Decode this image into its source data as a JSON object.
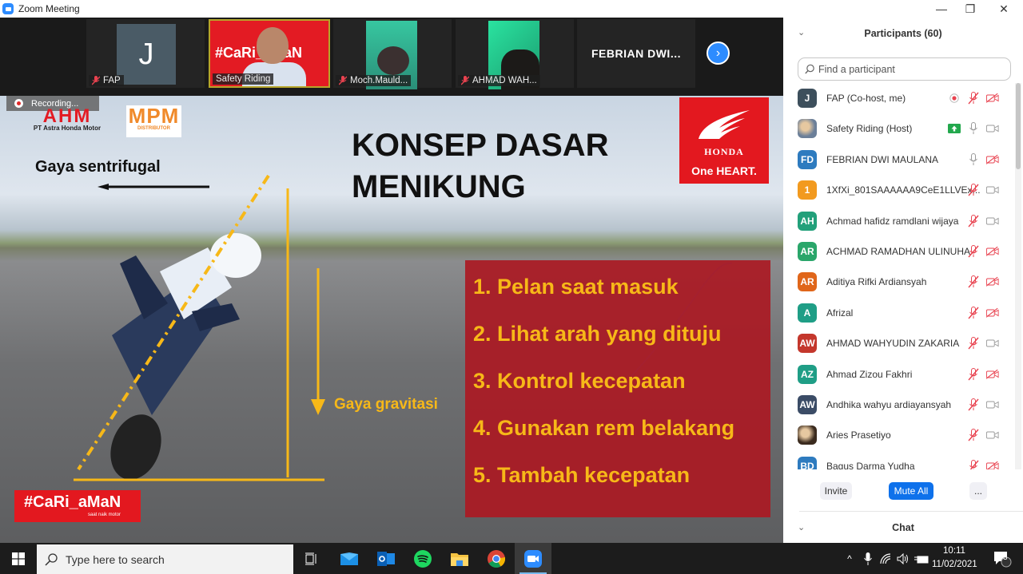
{
  "window": {
    "title": "Zoom Meeting",
    "controls": {
      "minimize": "—",
      "restore": "❐",
      "close": "✕"
    }
  },
  "video_strip": {
    "tiles": [
      {
        "name": "FAP",
        "avatar_letter": "J",
        "muted": true
      },
      {
        "name": "Safety Riding",
        "brand_text": "#CaRi_aMaN",
        "active_speaker": true,
        "muted": false
      },
      {
        "name": "Moch.Mauld...",
        "muted": true
      },
      {
        "name": "AHMAD WAH...",
        "muted": true
      },
      {
        "name": "FEBRIAN DWI...",
        "video_off": true
      }
    ],
    "next_icon": "›"
  },
  "share": {
    "recording_label": "Recording...",
    "slide": {
      "ahm_logo": "AHM",
      "ahm_sub": "PT Astra Honda Motor",
      "mpm_logo": "MPM",
      "mpm_sub": "DISTRIBUTOR",
      "title_line1": "KONSEP DASAR",
      "title_line2": "MENIKUNG",
      "honda_wing": "⟆",
      "honda_name": "HONDA",
      "honda_tagline": "One HEART.",
      "centrifugal_label": "Gaya sentrifugal",
      "gravity_label": "Gaya gravitasi",
      "steps": [
        "1.  Pelan saat masuk",
        "2.  Lihat arah yang dituju",
        "3.  Kontrol kecepatan",
        "4.  Gunakan rem belakang",
        "5.  Tambah kecepatan"
      ],
      "campaign_tag": "#CaRi_aMaN",
      "campaign_sub": "saat naik motor"
    }
  },
  "participants_panel": {
    "title": "Participants (60)",
    "search_placeholder": "Find a participant",
    "participants": [
      {
        "initials": "J",
        "color": "#3d4f5c",
        "name": "FAP (Co-host, me)",
        "recording": true,
        "mic": "muted",
        "video": "off"
      },
      {
        "initials": "",
        "color": "#6b7f99",
        "name": "Safety Riding (Host)",
        "sharing": true,
        "mic": "on",
        "video": "on",
        "photo": true
      },
      {
        "initials": "FD",
        "color": "#2e7bbf",
        "name": "FEBRIAN DWI MAULANA",
        "mic": "on",
        "video": "off"
      },
      {
        "initials": "1",
        "color": "#f29a1f",
        "name": "1XfXi_801SAAAAAA9CeE1LLVEx...",
        "mic": "muted",
        "video": "on"
      },
      {
        "initials": "AH",
        "color": "#22a07a",
        "name": "Achmad hafidz ramdlani wijaya",
        "mic": "muted",
        "video": "on"
      },
      {
        "initials": "AR",
        "color": "#2aa66a",
        "name": "ACHMAD RAMADHAN ULINUHA",
        "mic": "muted",
        "video": "off"
      },
      {
        "initials": "AR",
        "color": "#e0661a",
        "name": "Aditiya Rifki Ardiansyah",
        "mic": "muted",
        "video": "off"
      },
      {
        "initials": "A",
        "color": "#1f9e86",
        "name": "Afrizal",
        "mic": "muted",
        "video": "off"
      },
      {
        "initials": "AW",
        "color": "#c4372c",
        "name": "AHMAD WAHYUDIN ZAKARIA",
        "mic": "muted",
        "video": "on"
      },
      {
        "initials": "AZ",
        "color": "#1f9e86",
        "name": "Ahmad Zizou Fakhri",
        "mic": "muted",
        "video": "off"
      },
      {
        "initials": "AW",
        "color": "#3b4c66",
        "name": "Andhika wahyu ardiayansyah",
        "mic": "muted",
        "video": "on"
      },
      {
        "initials": "",
        "color": "#3a2a1e",
        "name": "Aries Prasetiyo",
        "mic": "muted",
        "video": "on",
        "photo": true
      },
      {
        "initials": "BD",
        "color": "#2e7bbf",
        "name": "Bagus Darma Yudha",
        "mic": "muted",
        "video": "off"
      }
    ],
    "buttons": {
      "invite": "Invite",
      "mute_all": "Mute All",
      "more": "..."
    },
    "chat_title": "Chat"
  },
  "taskbar": {
    "search_placeholder": "Type here to search",
    "apps": [
      "task-view",
      "mail",
      "outlook",
      "spotify",
      "file-explorer",
      "chrome",
      "zoom"
    ],
    "time": "10:11",
    "date": "11/02/2021",
    "notification_count": "3",
    "tray_up": "^"
  },
  "colors": {
    "zoom_blue": "#2D8CFF",
    "mute_all_blue": "#0e71eb",
    "muted_red": "#e8424f",
    "honda_red": "#e3181f",
    "slide_yellow": "#f7b818"
  }
}
